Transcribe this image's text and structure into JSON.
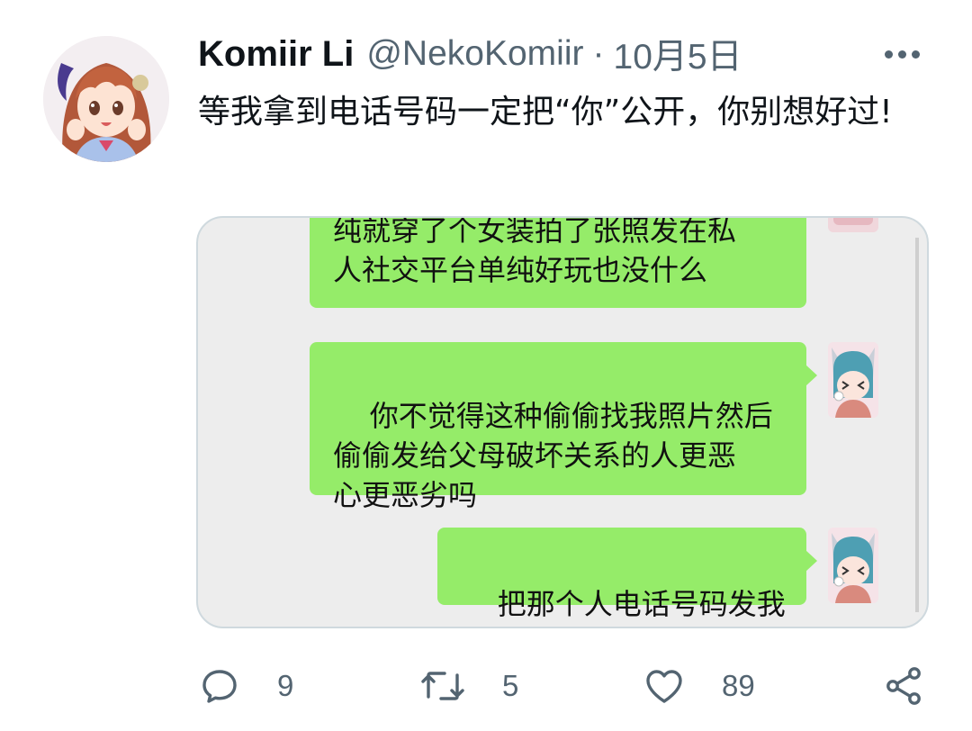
{
  "tweet": {
    "display_name": "Komiir Li",
    "handle": "@NekoKomiir",
    "separator": "·",
    "date": "10月5日",
    "text": "等我拿到电话号码一定把“你”公开，你别想好过!"
  },
  "media": {
    "messages": [
      {
        "text": "纯就穿了个女装拍了张照发在私\n人社交平台单纯好玩也没什么"
      },
      {
        "text": "你不觉得这种偷偷找我照片然后\n偷偷发给父母破坏关系的人更恶\n心更恶劣吗"
      },
      {
        "text": "把那个人电话号码发我"
      }
    ]
  },
  "actions": {
    "reply_count": "9",
    "retweet_count": "5",
    "like_count": "89"
  },
  "icons": {
    "more": "more-icon",
    "reply": "reply-icon",
    "retweet": "retweet-icon",
    "like": "heart-icon",
    "share": "share-icon"
  },
  "colors": {
    "bubble_green": "#95ec69",
    "chat_background": "#ededed",
    "secondary_text": "#536471"
  }
}
